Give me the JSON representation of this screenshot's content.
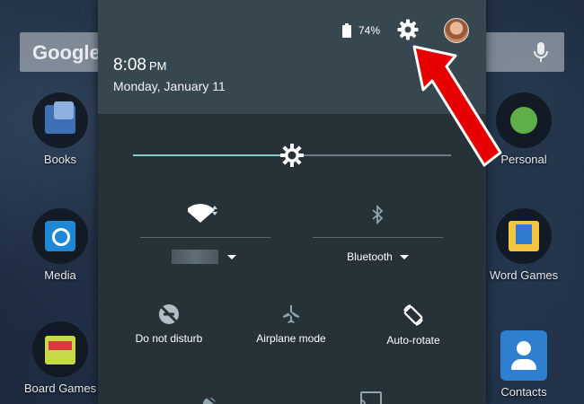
{
  "home": {
    "search_logo": "Google",
    "apps": [
      {
        "label": "Books"
      },
      {
        "label": "Personal"
      },
      {
        "label": "Media"
      },
      {
        "label": "Word Games"
      },
      {
        "label": "Board Games"
      },
      {
        "label": "Contacts"
      }
    ]
  },
  "status": {
    "battery_percent": "74%",
    "time": "8:08",
    "ampm": "PM",
    "date": "Monday, January 11"
  },
  "brightness": {
    "level": 0.5
  },
  "tiles": {
    "wifi_caret": "",
    "bluetooth_label": "Bluetooth",
    "do_not_disturb_label": "Do not disturb",
    "airplane_label": "Airplane mode",
    "autorotate_label": "Auto-rotate"
  },
  "colors": {
    "shade_bg": "#263238",
    "header_bg": "#37474f",
    "slider_accent": "#80cbc4",
    "annotation_arrow": "#e60000"
  },
  "icons": [
    "battery-icon",
    "gear-icon",
    "avatar",
    "brightness-icon",
    "wifi-icon",
    "bluetooth-icon",
    "do-not-disturb-icon",
    "airplane-icon",
    "autorotate-icon",
    "cast-icon",
    "location-off-icon",
    "mic-icon"
  ]
}
